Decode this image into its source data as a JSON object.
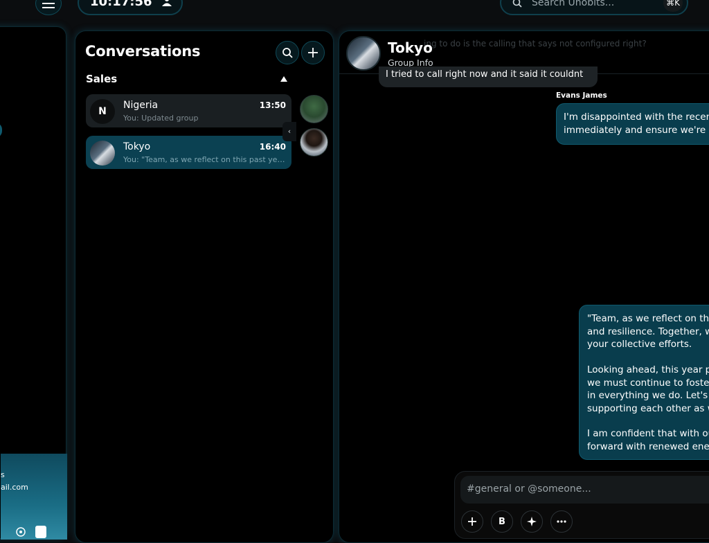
{
  "topbar": {
    "clock": "10:17:56",
    "search_placeholder": "Search Unobits...",
    "search_shortcut": "⌘K",
    "menu_icon": "menu-icon",
    "user_icon": "user-icon"
  },
  "sidebar": {
    "email_fragment": "ail.com",
    "fragment_top": "s"
  },
  "conversations": {
    "title": "Conversations",
    "group_label": "Sales",
    "items": [
      {
        "initial": "N",
        "name": "Nigeria",
        "time": "13:50",
        "preview": "You: Updated group"
      },
      {
        "initial": "",
        "name": "Tokyo",
        "time": "16:40",
        "preview": "You: \"Team, as we reflect on this past yea..."
      }
    ]
  },
  "chat": {
    "title": "Tokyo",
    "subtitle": "Group Info",
    "faded_message": "…ing to do is the calling that says not configured right?",
    "incoming_message": "I tried to call right now and it said it couldnt",
    "sender_name": "Evans James",
    "outgoing_1": "I'm disappointed with the recen\nimmediately and ensure we're n",
    "outgoing_2_p1": "\"Team, as we reflect on thi\nand resilience. Together, w\nyour collective efforts.",
    "outgoing_2_p2": "Looking ahead, this year p\nwe must continue to foste\nin everything we do. Let's f\nsupporting each other as w",
    "outgoing_2_p3": "I am confident that with ou\nforward with renewed ene",
    "composer_placeholder": "#general or @someone...",
    "bold_label": "B"
  },
  "colors": {
    "accent": "#093d4d",
    "accent_border": "#0f5a6e",
    "panel_glow": "#146e87"
  }
}
